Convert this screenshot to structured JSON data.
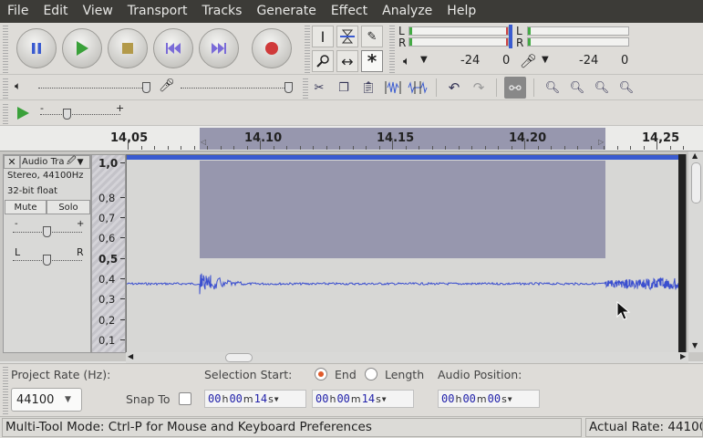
{
  "menu": [
    "File",
    "Edit",
    "View",
    "Transport",
    "Tracks",
    "Generate",
    "Effect",
    "Analyze",
    "Help"
  ],
  "transport": {
    "pause": "pause",
    "play": "play",
    "stop": "stop",
    "skip_start": "skip to start",
    "skip_end": "skip to end",
    "record": "record"
  },
  "tools": {
    "select": "selection tool",
    "envelope": "envelope tool",
    "draw": "draw tool",
    "zoom": "zoom tool",
    "timeshift": "time shift tool",
    "multi": "multi tool"
  },
  "meter": {
    "left": "L",
    "right": "R",
    "play_left": "L",
    "play_right": "R",
    "scale_left": [
      "-24",
      "0"
    ],
    "scale_right": [
      "-24",
      "0"
    ]
  },
  "ruler": {
    "labels": [
      "14,05",
      "14.10",
      "14.15",
      "14.20",
      "14,25"
    ]
  },
  "track": {
    "name": "Audio Tra",
    "info1": "Stereo, 44100Hz",
    "info2": "32-bit float",
    "mute": "Mute",
    "solo": "Solo",
    "gain_minus": "-",
    "gain_plus": "+",
    "pan_left": "L",
    "pan_right": "R",
    "scale": [
      "1,0",
      "0,8",
      "0,7",
      "0,6",
      "0,5",
      "0,4",
      "0,3",
      "0,2",
      "0,1"
    ]
  },
  "selection_bar": {
    "project_rate_label": "Project Rate (Hz):",
    "project_rate_value": "44100",
    "snap_to_label": "Snap To",
    "selection_start_label": "Selection Start:",
    "end_label": "End",
    "length_label": "Length",
    "audio_position_label": "Audio Position:",
    "sel_start": {
      "h": "00",
      "m": "00",
      "s": "14",
      "unit_h": "h",
      "unit_m": "m",
      "unit_s": "s"
    },
    "sel_end": {
      "h": "00",
      "m": "00",
      "s": "14",
      "unit_h": "h",
      "unit_m": "m",
      "unit_s": "s"
    },
    "audio_pos": {
      "h": "00",
      "m": "00",
      "s": "00",
      "unit_h": "h",
      "unit_m": "m",
      "unit_s": "s"
    }
  },
  "status": {
    "mode": "Multi-Tool Mode: Ctrl-P for Mouse and Keyboard Preferences",
    "rate": "Actual Rate: 44100"
  },
  "colors": {
    "menubar": "#3c3b37",
    "selection": "#9797ae",
    "waveform": "#3b4fcf",
    "background": "#e0e0de"
  }
}
